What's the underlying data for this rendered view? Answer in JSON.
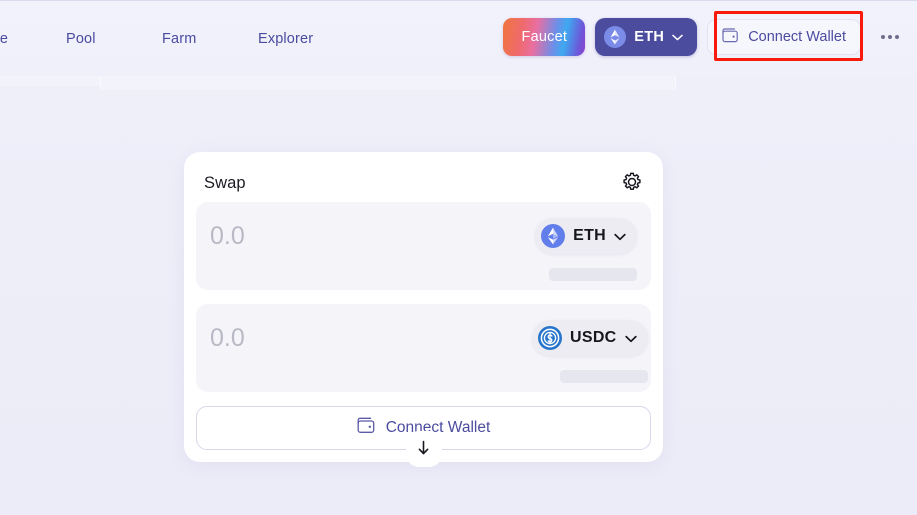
{
  "theme": {
    "page_bg": "#eeeefa",
    "card_bg": "#ffffff",
    "input_row_bg": "#f5f5f9",
    "accent_indigo": "#4b4ba0",
    "chain_button_bg": "#4b4c9e",
    "eth_blue": "#627eea",
    "usdc_blue": "#2775ca",
    "highlight_red": "#f81b0c",
    "skeleton_gray": "#e6e6ee"
  },
  "header": {
    "nav_items": [
      {
        "label": "Trade",
        "name": "nav-trade"
      },
      {
        "label": "Pool",
        "name": "nav-pool"
      },
      {
        "label": "Farm",
        "name": "nav-farm"
      },
      {
        "label": "Explorer",
        "name": "nav-explorer"
      }
    ],
    "faucet_label": "Faucet",
    "chain": {
      "label": "ETH",
      "icon": "ethereum-icon",
      "chevron": "chevron-down-icon"
    },
    "connect_wallet_label": "Connect Wallet",
    "wallet_icon": "wallet-icon",
    "more_icon": "more-horizontal-icon"
  },
  "swap": {
    "title": "Swap",
    "settings_icon": "gear-icon",
    "switch_icon": "arrow-down-icon",
    "from": {
      "amount_value": "",
      "amount_placeholder": "0.0",
      "token_symbol": "ETH",
      "token_icon": "ethereum-icon",
      "chevron": "chevron-down-icon",
      "balance_loading": true
    },
    "to": {
      "amount_value": "",
      "amount_placeholder": "0.0",
      "token_symbol": "USDC",
      "token_icon": "usdc-icon",
      "chevron": "chevron-down-icon",
      "balance_loading": true
    },
    "action_label": "Connect Wallet",
    "action_icon": "wallet-icon"
  }
}
